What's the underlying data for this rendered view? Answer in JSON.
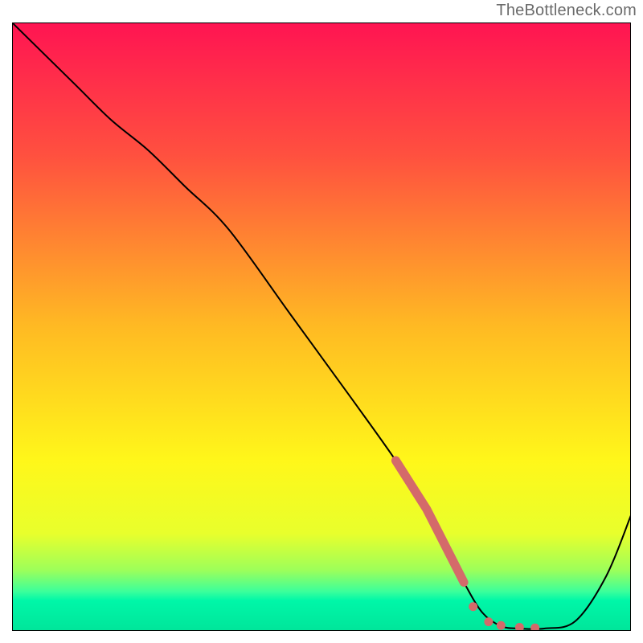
{
  "watermark": "TheBottleneck.com",
  "chart_data": {
    "type": "line",
    "title": "",
    "xlabel": "",
    "ylabel": "",
    "xlim": [
      0,
      100
    ],
    "ylim": [
      0,
      100
    ],
    "grid": false,
    "background_gradient": {
      "stops": [
        {
          "offset": 0,
          "color": "#ff1452"
        },
        {
          "offset": 22,
          "color": "#ff513f"
        },
        {
          "offset": 50,
          "color": "#ffba23"
        },
        {
          "offset": 72,
          "color": "#fff71a"
        },
        {
          "offset": 84,
          "color": "#e8ff2c"
        },
        {
          "offset": 90,
          "color": "#9dff5a"
        },
        {
          "offset": 93.5,
          "color": "#3cff9b"
        },
        {
          "offset": 95,
          "color": "#00f7a8"
        },
        {
          "offset": 100,
          "color": "#00e59a"
        }
      ]
    },
    "curve": {
      "x": [
        0,
        10,
        16,
        22,
        28,
        35,
        45,
        55,
        62,
        67,
        70,
        73,
        76,
        79,
        82,
        86,
        91,
        96,
        100
      ],
      "y": [
        100,
        90,
        84,
        79,
        73,
        66,
        52,
        38,
        28,
        20,
        14,
        8,
        3,
        0.8,
        0.4,
        0.4,
        1.6,
        9,
        19
      ]
    },
    "highlight_dashes": {
      "main_segment": {
        "x": [
          62,
          67,
          70,
          73
        ],
        "y": [
          28,
          20,
          14,
          8
        ]
      },
      "dots": [
        {
          "x": 74.5,
          "y": 4
        },
        {
          "x": 77,
          "y": 1.5
        },
        {
          "x": 79,
          "y": 0.9
        },
        {
          "x": 82,
          "y": 0.6
        },
        {
          "x": 84.5,
          "y": 0.5
        }
      ]
    },
    "colors": {
      "curve": "#000000",
      "highlight": "#d46a6a",
      "frame": "#000000"
    }
  }
}
